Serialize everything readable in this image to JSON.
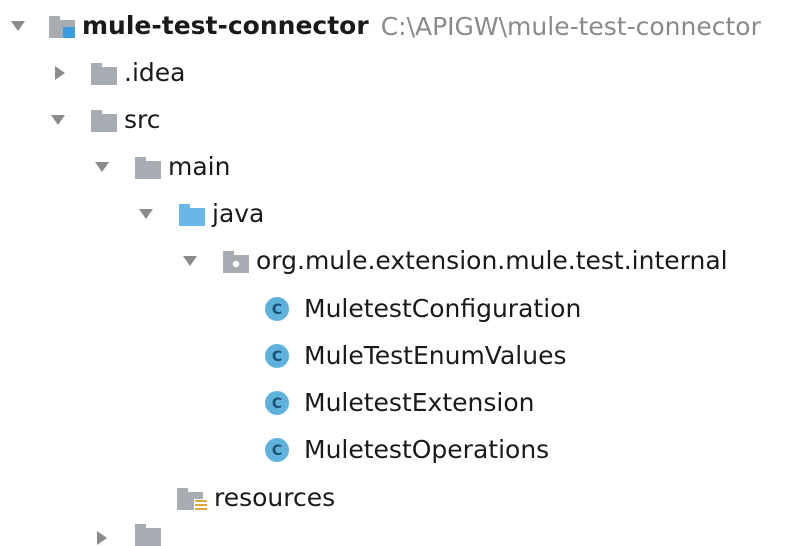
{
  "tree": {
    "root": {
      "label": "mule-test-connector",
      "path": "C:\\APIGW\\mule-test-connector"
    },
    "idea": {
      "label": ".idea"
    },
    "src": {
      "label": "src"
    },
    "main": {
      "label": "main"
    },
    "java": {
      "label": "java"
    },
    "package": {
      "label": "org.mule.extension.mule.test.internal"
    },
    "classes": [
      {
        "label": "MuletestConfiguration",
        "icon": "class-icon"
      },
      {
        "label": "MuleTestEnumValues",
        "icon": "class-icon"
      },
      {
        "label": "MuletestExtension",
        "icon": "class-icon"
      },
      {
        "label": "MuletestOperations",
        "icon": "class-icon"
      }
    ],
    "resources": {
      "label": "resources"
    }
  },
  "colors": {
    "folder_gray": "#a7acb2",
    "folder_blue": "#69b7e8",
    "class_icon": "#5eb2dc",
    "arrow": "#8b8b8b",
    "path_text": "#8a8a8a"
  }
}
